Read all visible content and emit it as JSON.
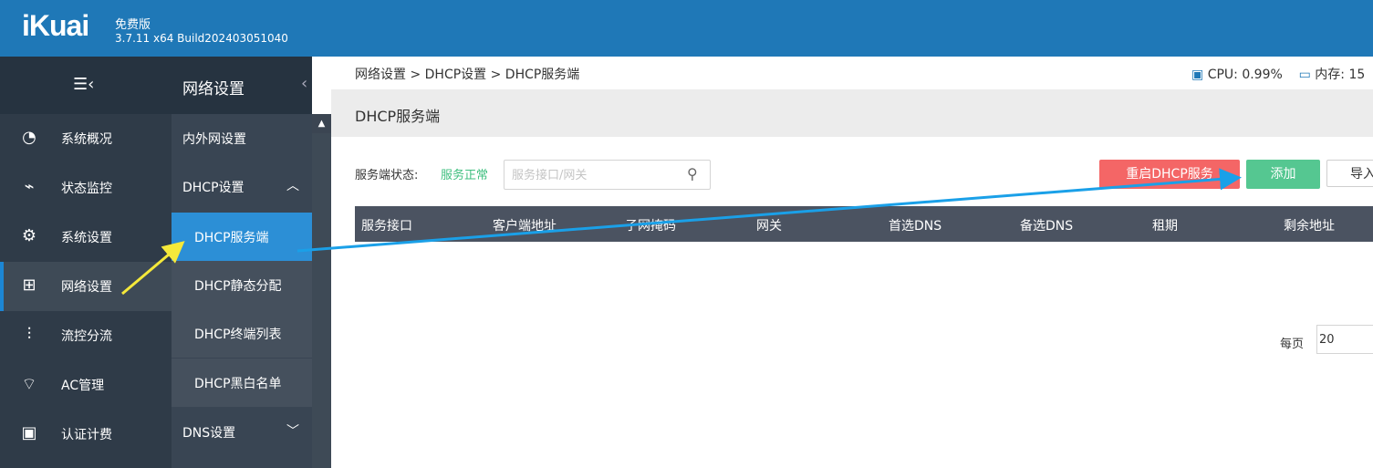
{
  "header": {
    "logo": "iKuai",
    "edition": "免费版",
    "version": "3.7.11 x64 Build202403051040"
  },
  "nav1": {
    "items": [
      {
        "label": "系统概况",
        "icon": "dashboard-gauge-icon"
      },
      {
        "label": "状态监控",
        "icon": "monitor-pulse-icon"
      },
      {
        "label": "系统设置",
        "icon": "gear-icon"
      },
      {
        "label": "网络设置",
        "icon": "network-topology-icon",
        "active": true
      },
      {
        "label": "流控分流",
        "icon": "sliders-icon"
      },
      {
        "label": "AC管理",
        "icon": "wifi-box-icon"
      },
      {
        "label": "认证计费",
        "icon": "id-card-icon"
      }
    ]
  },
  "nav2": {
    "title": "网络设置",
    "items": {
      "wan_lan": "内外网设置",
      "dhcp": "DHCP设置",
      "dhcp_server": "DHCP服务端",
      "dhcp_static": "DHCP静态分配",
      "dhcp_clients": "DHCP终端列表",
      "dhcp_blackwhite": "DHCP黑白名单",
      "dns": "DNS设置"
    }
  },
  "breadcrumb": "网络设置 > DHCP设置 > DHCP服务端",
  "stats": {
    "cpu": "CPU: 0.99%",
    "mem": "内存: 15"
  },
  "page": {
    "title": "DHCP服务端",
    "status_label": "服务端状态:",
    "status_value": "服务正常",
    "search_placeholder": "服务接口/网关",
    "restart_button": "重启DHCP服务",
    "add_button": "添加",
    "import_button": "导入"
  },
  "table": {
    "columns": [
      "服务接口",
      "客户端地址",
      "子网掩码",
      "网关",
      "首选DNS",
      "备选DNS",
      "租期",
      "剩余地址"
    ]
  },
  "pager": {
    "per_page_label": "每页",
    "per_page_value": "20"
  },
  "colors": {
    "header": "#1f78b7",
    "active_sub": "#2c8fd6",
    "restart": "#f46666",
    "add": "#55c791",
    "status_ok": "#3fbf7f",
    "table_head": "#4b5361"
  }
}
